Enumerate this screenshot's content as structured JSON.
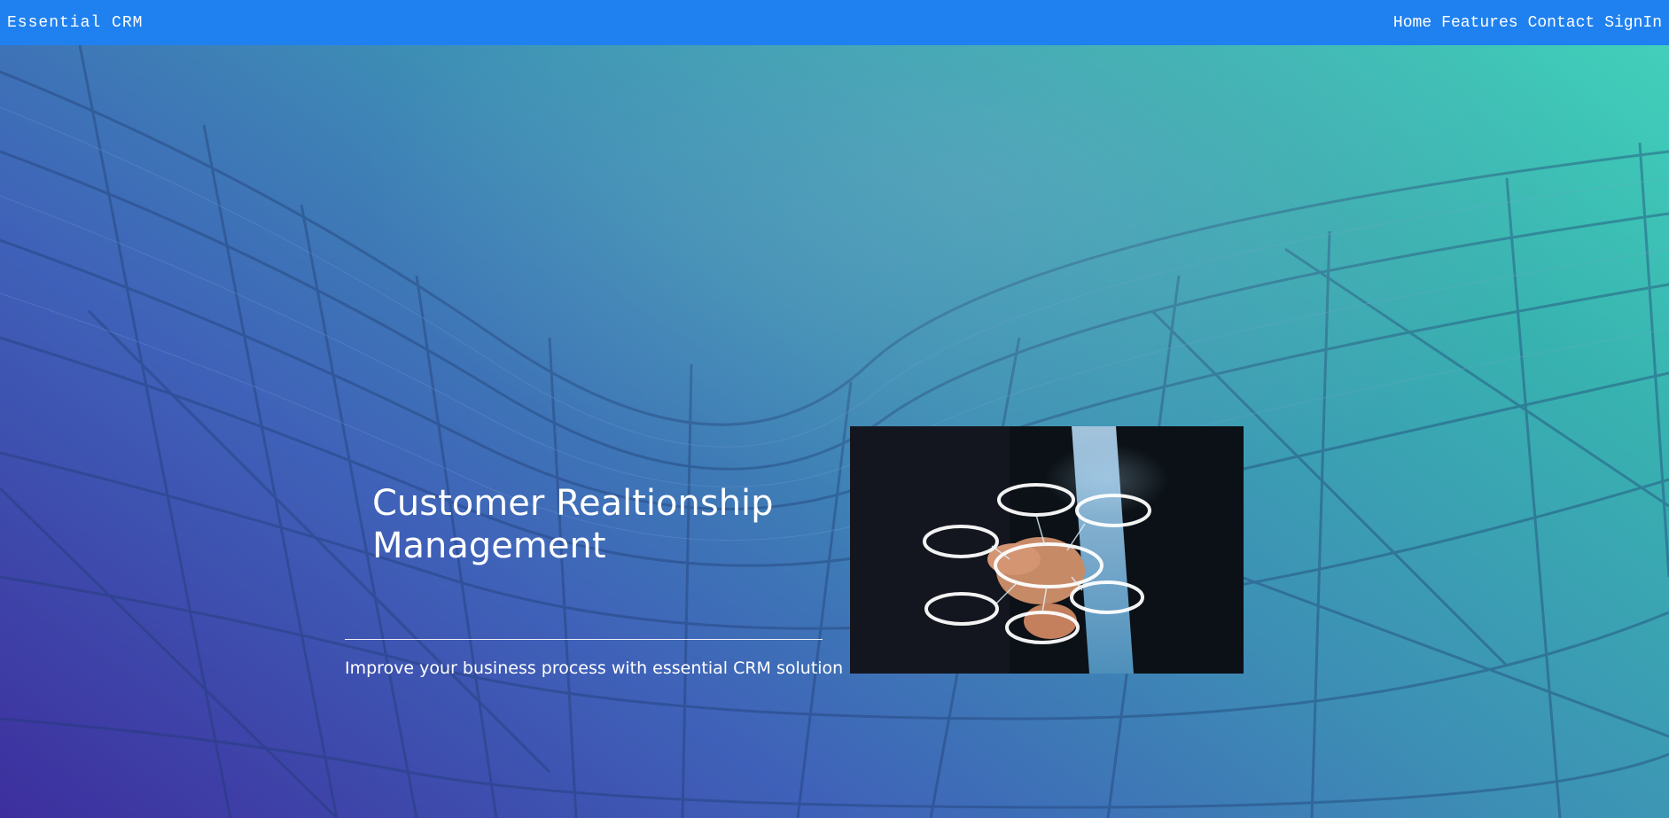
{
  "nav": {
    "brand": "Essential CRM",
    "links": [
      "Home",
      "Features",
      "Contact",
      "SignIn"
    ]
  },
  "hero": {
    "title": "Customer Realtionship Management",
    "subtitle": "Improve your business process with essential CRM solution",
    "image_icon": "hand-touching-network-icon"
  },
  "colors": {
    "navbar": "#1f81f0",
    "gradient_start": "#3d2f9e",
    "gradient_end": "#42cfba"
  }
}
